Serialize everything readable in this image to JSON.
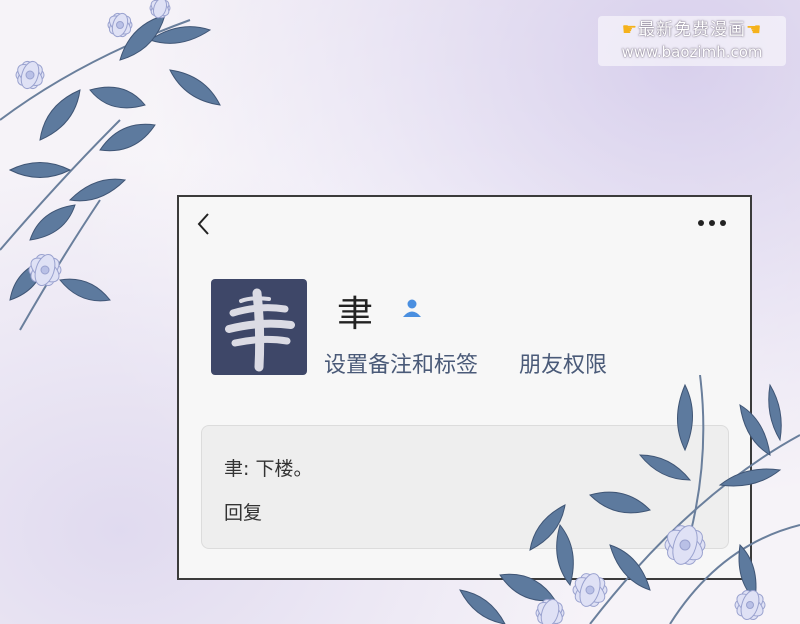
{
  "watermark": {
    "line1": "最新免费漫画",
    "line2": "www.baozimh.com",
    "hand_icon": "pointing-hand-icon"
  },
  "profile": {
    "avatar_glyph": "聿",
    "name": "聿",
    "badge_icon": "user-icon",
    "set_remark_label": "设置备注和标签",
    "friend_permission_label": "朋友权限"
  },
  "toolbar": {
    "back_icon": "chevron-left-icon",
    "more_icon": "more-dots-icon"
  },
  "message": {
    "text": "聿: 下楼。",
    "reply_label": "回复"
  },
  "colors": {
    "avatar_bg": "#3e4768",
    "link": "#4a5a78",
    "leaf": "#5d7a9e",
    "flower": "#d9dcf3"
  }
}
